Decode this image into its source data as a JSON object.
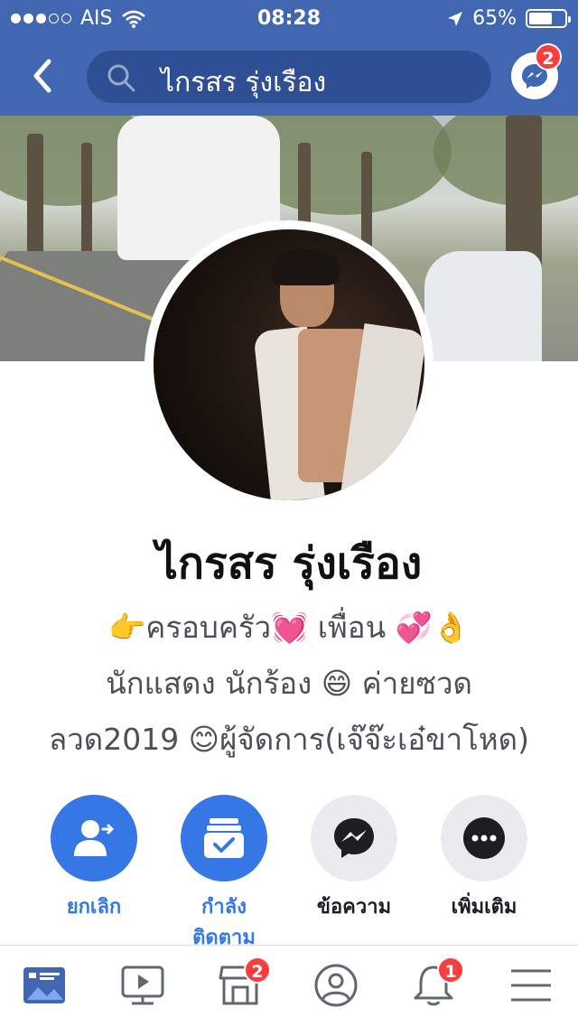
{
  "status_bar": {
    "carrier": "AIS",
    "time": "08:28",
    "battery": "65%",
    "battery_level": 0.65,
    "signal_bars": 3
  },
  "nav": {
    "back_icon": "chevron-left-icon",
    "search_value": "ไกรสร รุ่งเรือง",
    "messenger_badge": "2"
  },
  "profile": {
    "name": "ไกรสร รุ่งเรือง",
    "bio_lines": [
      "👉ครอบครัว💓 เพื่อน 💞👌",
      "นักแสดง นักร้อง  😄 ค่ายซวด",
      "ลวด2019 😊ผู้จัดการ(เจ๊จ๊ะเอ๋ขาโหด)"
    ]
  },
  "actions": [
    {
      "label": "ยกเลิก",
      "icon": "unfriend-icon"
    },
    {
      "label": "กำลัง\nติดตาม",
      "icon": "following-icon"
    },
    {
      "label": "ข้อความ",
      "icon": "messenger-icon"
    },
    {
      "label": "เพิ่มเติม",
      "icon": "more-icon"
    }
  ],
  "tabbar": {
    "items": [
      {
        "name": "news-feed",
        "badge": ""
      },
      {
        "name": "watch",
        "badge": ""
      },
      {
        "name": "marketplace",
        "badge": "2"
      },
      {
        "name": "profile",
        "badge": ""
      },
      {
        "name": "notifications",
        "badge": "1"
      },
      {
        "name": "menu",
        "badge": ""
      }
    ]
  },
  "colors": {
    "header": "#4267b2",
    "search_bg": "#2f4f94",
    "accent": "#3578e5",
    "badge": "#fa3e3e",
    "grey_button": "#e9ebee"
  }
}
